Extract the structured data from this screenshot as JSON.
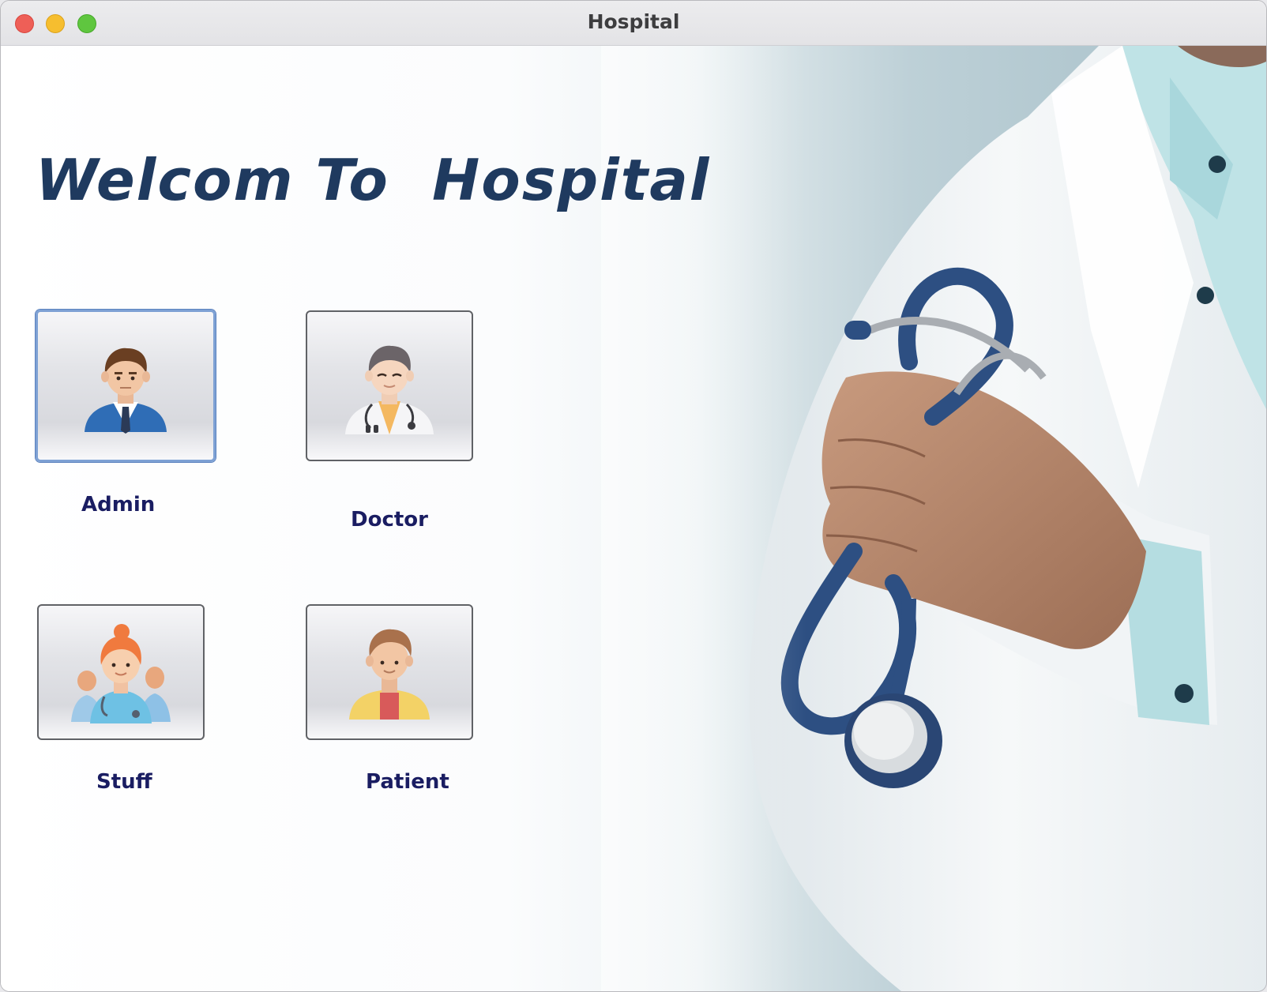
{
  "window": {
    "title": "Hospital"
  },
  "main": {
    "heading": "Welcom To  Hospital",
    "roles": [
      {
        "label": "Admin"
      },
      {
        "label": "Doctor"
      },
      {
        "label": "Stuff"
      },
      {
        "label": "Patient"
      }
    ]
  },
  "colors": {
    "heading": "#1f3a5f",
    "label": "#1a1d62",
    "focus_ring": "#7ea1d4"
  },
  "icons": {
    "admin": "admin-avatar-icon",
    "doctor": "doctor-avatar-icon",
    "stuff": "staff-group-icon",
    "patient": "patient-avatar-icon"
  }
}
